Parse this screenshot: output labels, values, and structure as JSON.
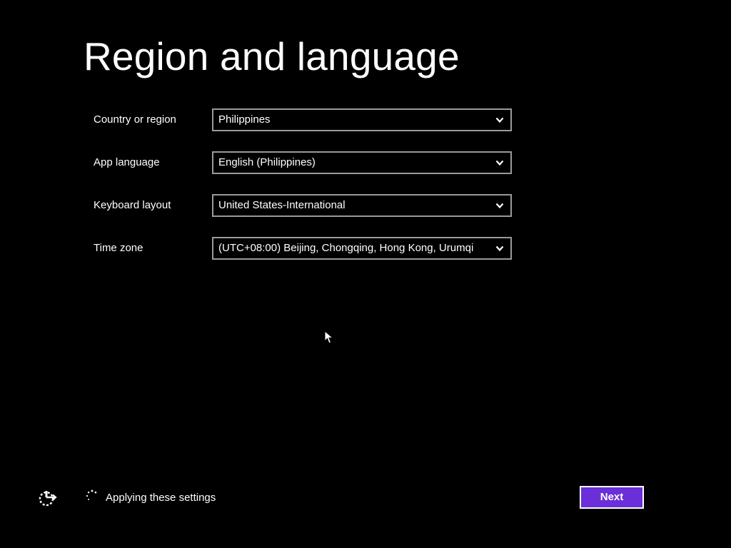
{
  "title": "Region and language",
  "fields": [
    {
      "label": "Country or region",
      "value": "Philippines"
    },
    {
      "label": "App language",
      "value": "English (Philippines)"
    },
    {
      "label": "Keyboard layout",
      "value": "United States-International"
    },
    {
      "label": "Time zone",
      "value": "(UTC+08:00) Beijing, Chongqing, Hong Kong, Urumqi"
    }
  ],
  "footer": {
    "status_text": "Applying these settings",
    "next_label": "Next",
    "ease_of_access_icon": "ease-of-access-icon",
    "spinner_icon": "loading-spinner-icon"
  },
  "colors": {
    "background": "#000000",
    "accent": "#6a2fd8",
    "field_border": "#9a9a9a",
    "text": "#ffffff"
  }
}
